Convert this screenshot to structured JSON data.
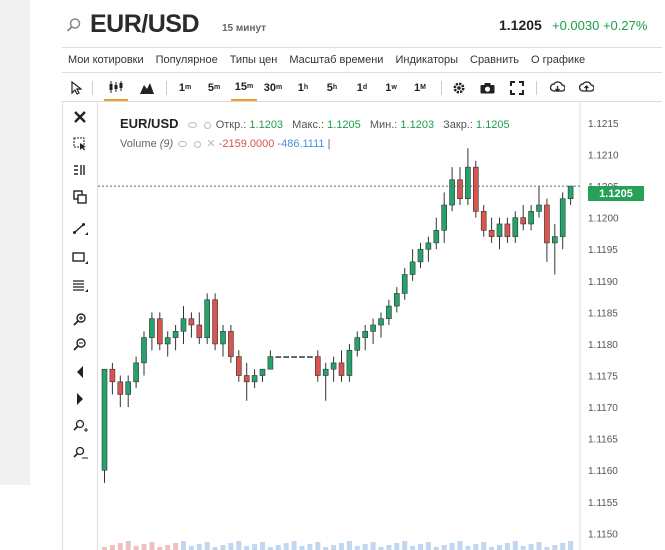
{
  "header": {
    "symbol": "EUR/USD",
    "timeframe": "15 минут",
    "last_price": "1.1205",
    "change": "+0.0030 +0.27%"
  },
  "menu": [
    "Мои котировки",
    "Популярное",
    "Типы цен",
    "Масштаб времени",
    "Индикаторы",
    "Сравнить",
    "О графике"
  ],
  "toolbar": {
    "intervals": [
      "1m",
      "5m",
      "15m",
      "30m",
      "1h",
      "5h",
      "1d",
      "1w",
      "1M"
    ],
    "active_interval": "15m",
    "icons": [
      "cursor-icon",
      "candles-icon",
      "area-icon",
      "settings-icon",
      "camera-icon",
      "fullscreen-icon",
      "download-icon",
      "upload-icon"
    ]
  },
  "sidebar_icons": [
    "close-icon",
    "crosshair-icon",
    "fib-icon",
    "layers-icon",
    "line-icon",
    "rect-icon",
    "lines-icon",
    "zoom-in-icon",
    "zoom-out-icon",
    "bell-left-icon",
    "bell-right-icon",
    "zoom-plus-icon",
    "zoom-reset-icon"
  ],
  "legend": {
    "symbol": "EUR/USD",
    "open_label": "Откр.:",
    "open": "1.1203",
    "high_label": "Макс.:",
    "high": "1.1205",
    "low_label": "Мин.:",
    "low": "1.1203",
    "close_label": "Закр.:",
    "close": "1.1205",
    "volume_label": "Volume",
    "volume_period": "(9)",
    "volume_val1": "-2159.0000",
    "volume_val2": "-486.1111"
  },
  "colors": {
    "up": "#26a36a",
    "down": "#d9534f",
    "price_tag": "#27a05a",
    "change": "#1e9e48"
  },
  "chart_data": {
    "type": "candlestick",
    "price_axis_ticks": [
      "1.1215",
      "1.1210",
      "1.1205",
      "1.1200",
      "1.1195",
      "1.1190",
      "1.1185",
      "1.1180",
      "1.1175",
      "1.1170",
      "1.1165",
      "1.1160",
      "1.1155",
      "1.1150"
    ],
    "current_price": "1.1205",
    "ylim": [
      1.1148,
      1.1218
    ],
    "candles": [
      [
        1.116,
        1.1176,
        1.1158,
        1.1176
      ],
      [
        1.1176,
        1.1177,
        1.1172,
        1.1174
      ],
      [
        1.1174,
        1.1175,
        1.117,
        1.1172
      ],
      [
        1.1172,
        1.1175,
        1.117,
        1.1174
      ],
      [
        1.1174,
        1.1178,
        1.1173,
        1.1177
      ],
      [
        1.1177,
        1.1182,
        1.1175,
        1.1181
      ],
      [
        1.1181,
        1.1185,
        1.1179,
        1.1184
      ],
      [
        1.1184,
        1.1185,
        1.1179,
        1.118
      ],
      [
        1.118,
        1.1182,
        1.1178,
        1.1181
      ],
      [
        1.1181,
        1.1183,
        1.1179,
        1.1182
      ],
      [
        1.1182,
        1.1186,
        1.118,
        1.1184
      ],
      [
        1.1184,
        1.1185,
        1.1181,
        1.1183
      ],
      [
        1.1183,
        1.1185,
        1.118,
        1.1181
      ],
      [
        1.1181,
        1.1188,
        1.118,
        1.1187
      ],
      [
        1.1187,
        1.1188,
        1.1179,
        1.118
      ],
      [
        1.118,
        1.1183,
        1.1178,
        1.1182
      ],
      [
        1.1182,
        1.1183,
        1.1177,
        1.1178
      ],
      [
        1.1178,
        1.1179,
        1.1174,
        1.1175
      ],
      [
        1.1175,
        1.1177,
        1.1171,
        1.1174
      ],
      [
        1.1174,
        1.1176,
        1.1173,
        1.1175
      ],
      [
        1.1175,
        1.1176,
        1.1174,
        1.1176
      ],
      [
        1.1176,
        1.1179,
        1.1176,
        1.1178
      ],
      [
        1.1178,
        1.1178,
        1.1178,
        1.1178
      ],
      [
        1.1178,
        1.1178,
        1.1178,
        1.1178
      ],
      [
        1.1178,
        1.1178,
        1.1178,
        1.1178
      ],
      [
        1.1178,
        1.1178,
        1.1178,
        1.1178
      ],
      [
        1.1178,
        1.1178,
        1.1178,
        1.1178
      ],
      [
        1.1178,
        1.1179,
        1.1174,
        1.1175
      ],
      [
        1.1175,
        1.1177,
        1.1171,
        1.1176
      ],
      [
        1.1176,
        1.1178,
        1.1174,
        1.1177
      ],
      [
        1.1177,
        1.1179,
        1.1174,
        1.1175
      ],
      [
        1.1175,
        1.118,
        1.1174,
        1.1179
      ],
      [
        1.1179,
        1.1182,
        1.1178,
        1.1181
      ],
      [
        1.1181,
        1.1183,
        1.1179,
        1.1182
      ],
      [
        1.1182,
        1.1184,
        1.118,
        1.1183
      ],
      [
        1.1183,
        1.1185,
        1.1181,
        1.1184
      ],
      [
        1.1184,
        1.1187,
        1.1183,
        1.1186
      ],
      [
        1.1186,
        1.1189,
        1.1185,
        1.1188
      ],
      [
        1.1188,
        1.1192,
        1.1187,
        1.1191
      ],
      [
        1.1191,
        1.1195,
        1.119,
        1.1193
      ],
      [
        1.1193,
        1.1196,
        1.1192,
        1.1195
      ],
      [
        1.1195,
        1.1197,
        1.1193,
        1.1196
      ],
      [
        1.1196,
        1.12,
        1.1195,
        1.1198
      ],
      [
        1.1198,
        1.1204,
        1.1196,
        1.1202
      ],
      [
        1.1202,
        1.1208,
        1.1201,
        1.1206
      ],
      [
        1.1206,
        1.1208,
        1.1202,
        1.1203
      ],
      [
        1.1203,
        1.1211,
        1.1202,
        1.1208
      ],
      [
        1.1208,
        1.1209,
        1.12,
        1.1201
      ],
      [
        1.1201,
        1.1202,
        1.1197,
        1.1198
      ],
      [
        1.1198,
        1.12,
        1.1196,
        1.1197
      ],
      [
        1.1197,
        1.12,
        1.1195,
        1.1199
      ],
      [
        1.1199,
        1.12,
        1.1196,
        1.1197
      ],
      [
        1.1197,
        1.1201,
        1.1196,
        1.12
      ],
      [
        1.12,
        1.1202,
        1.1198,
        1.1199
      ],
      [
        1.1199,
        1.1202,
        1.1198,
        1.1201
      ],
      [
        1.1201,
        1.1205,
        1.12,
        1.1202
      ],
      [
        1.1202,
        1.1203,
        1.1193,
        1.1196
      ],
      [
        1.1196,
        1.1199,
        1.1191,
        1.1197
      ],
      [
        1.1197,
        1.1204,
        1.1195,
        1.1203
      ],
      [
        1.1203,
        1.1205,
        1.1202,
        1.1205
      ]
    ]
  }
}
